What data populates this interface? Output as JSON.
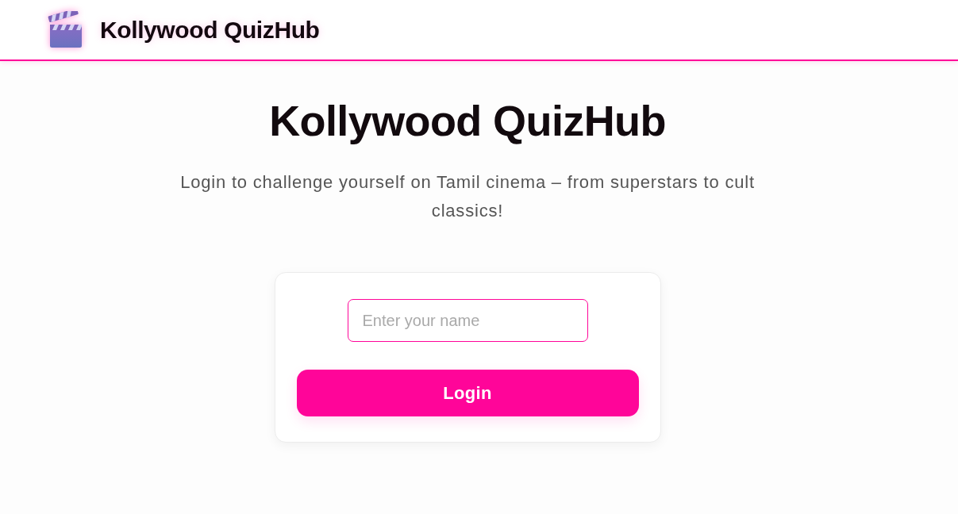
{
  "header": {
    "title": "Kollywood QuizHub"
  },
  "hero": {
    "title": "Kollywood QuizHub",
    "subtitle": "Login to challenge yourself on Tamil cinema – from superstars to cult classics!"
  },
  "login_card": {
    "name_field": {
      "placeholder": "Enter your name"
    },
    "button": "Login"
  }
}
